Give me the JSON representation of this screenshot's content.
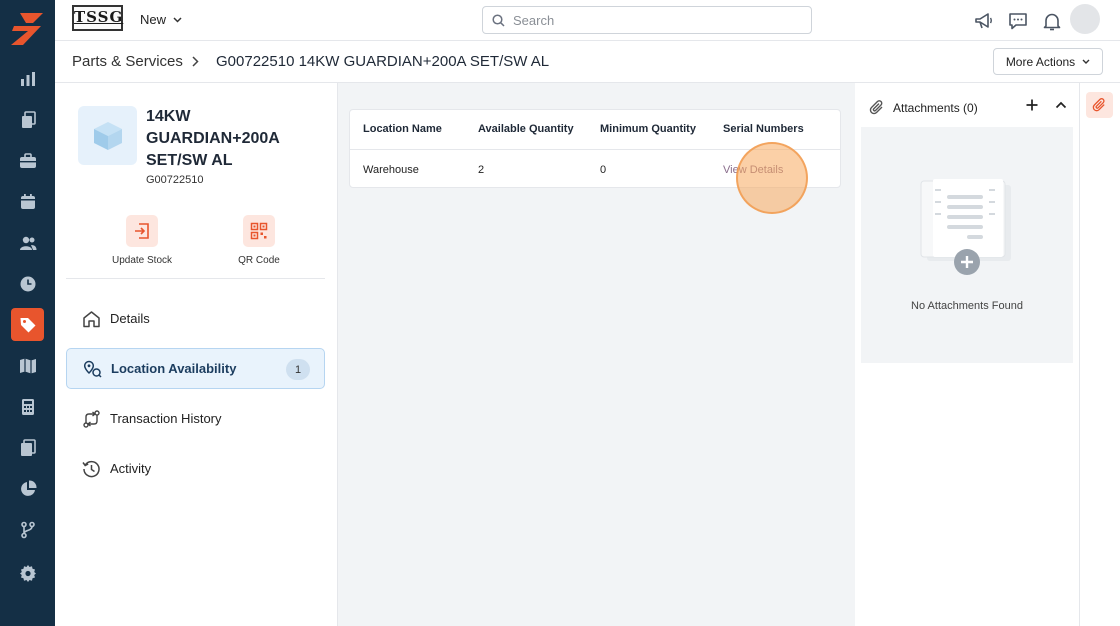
{
  "app": {
    "brand_logo_text": "TSSG",
    "new_label": "New",
    "search_placeholder": "Search"
  },
  "rail": {
    "items": [
      "reports-icon",
      "documents-icon",
      "jobs-icon",
      "calendar-icon",
      "customers-icon",
      "time-icon",
      "parts-tag-icon",
      "map-icon",
      "calculator-icon",
      "files-icon",
      "pie-chart-icon",
      "workflow-icon",
      "settings-icon"
    ],
    "active": "parts-tag-icon",
    "active_color": "#e8552d",
    "background": "#142f45"
  },
  "breadcrumb": {
    "parent": "Parts & Services",
    "current": "G00722510 14KW GUARDIAN+200A SET/SW AL",
    "more_actions": "More Actions"
  },
  "item": {
    "title": "14KW GUARDIAN+200A SET/SW AL",
    "sku": "G00722510",
    "actions": [
      {
        "label": "Update Stock",
        "icon": "update-stock-icon"
      },
      {
        "label": "QR Code",
        "icon": "qr-code-icon"
      }
    ]
  },
  "nav": [
    {
      "label": "Details",
      "icon": "home-icon"
    },
    {
      "label": "Location Availability",
      "icon": "location-icon",
      "badge": "1",
      "active": true
    },
    {
      "label": "Transaction History",
      "icon": "transaction-icon"
    },
    {
      "label": "Activity",
      "icon": "history-icon"
    }
  ],
  "table": {
    "headers": [
      "Location Name",
      "Available Quantity",
      "Minimum Quantity",
      "Serial Numbers"
    ],
    "rows": [
      {
        "location": "Warehouse",
        "available": "2",
        "minimum": "0",
        "serial_link": "View Details"
      }
    ]
  },
  "attachments": {
    "title": "Attachments (0)",
    "empty_text": "No Attachments Found"
  }
}
